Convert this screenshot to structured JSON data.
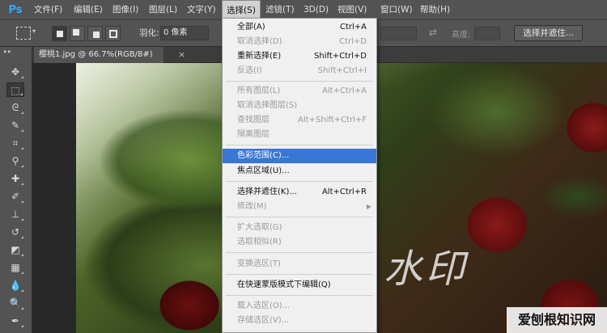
{
  "app": {
    "logo": "Ps"
  },
  "menubar": {
    "items": [
      {
        "label": "文件(F)"
      },
      {
        "label": "编辑(E)"
      },
      {
        "label": "图像(I)"
      },
      {
        "label": "图层(L)"
      },
      {
        "label": "文字(Y)"
      },
      {
        "label": "选择(S)",
        "active": true
      },
      {
        "label": "滤镜(T)"
      },
      {
        "label": "3D(D)"
      },
      {
        "label": "视图(V)"
      },
      {
        "label": "窗口(W)"
      },
      {
        "label": "帮助(H)"
      }
    ]
  },
  "options": {
    "feather_label": "羽化:",
    "feather_value": "0 像素",
    "height_label": "高度:",
    "refine_button": "选择并遮住..."
  },
  "document": {
    "tab_title": "樱桃1.jpg @ 66.7%(RGB/8#)",
    "tab_close": "×",
    "watermark": "水印",
    "site_mark": "爱刨根知识网"
  },
  "select_menu": {
    "items": [
      {
        "label": "全部(A)",
        "shortcut": "Ctrl+A",
        "enabled": true
      },
      {
        "label": "取消选择(D)",
        "shortcut": "Ctrl+D",
        "enabled": false
      },
      {
        "label": "重新选择(E)",
        "shortcut": "Shift+Ctrl+D",
        "enabled": true
      },
      {
        "label": "反选(I)",
        "shortcut": "Shift+Ctrl+I",
        "enabled": false
      },
      {
        "label": "所有图层(L)",
        "shortcut": "Alt+Ctrl+A",
        "enabled": false
      },
      {
        "label": "取消选择图层(S)",
        "shortcut": "",
        "enabled": false
      },
      {
        "label": "查找图层",
        "shortcut": "Alt+Shift+Ctrl+F",
        "enabled": false
      },
      {
        "label": "隔离图层",
        "shortcut": "",
        "enabled": false
      },
      {
        "label": "色彩范围(C)...",
        "shortcut": "",
        "enabled": true,
        "highlighted": true
      },
      {
        "label": "焦点区域(U)...",
        "shortcut": "",
        "enabled": true
      },
      {
        "label": "选择并遮住(K)...",
        "shortcut": "Alt+Ctrl+R",
        "enabled": true
      },
      {
        "label": "修改(M)",
        "shortcut": "",
        "enabled": false,
        "submenu": true
      },
      {
        "label": "扩大选取(G)",
        "shortcut": "",
        "enabled": false
      },
      {
        "label": "选取相似(R)",
        "shortcut": "",
        "enabled": false
      },
      {
        "label": "变换选区(T)",
        "shortcut": "",
        "enabled": false
      },
      {
        "label": "在快速蒙版模式下编辑(Q)",
        "shortcut": "",
        "enabled": true
      },
      {
        "label": "载入选区(O)...",
        "shortcut": "",
        "enabled": false
      },
      {
        "label": "存储选区(V)...",
        "shortcut": "",
        "enabled": false
      }
    ],
    "submenu_arrow": "▶"
  },
  "tools": [
    {
      "name": "move-tool-icon",
      "glyph": "✥"
    },
    {
      "name": "rect-marquee-tool-icon",
      "glyph": "⬚",
      "active": true
    },
    {
      "name": "lasso-tool-icon",
      "glyph": "ᘓ"
    },
    {
      "name": "quick-select-tool-icon",
      "glyph": "✎"
    },
    {
      "name": "crop-tool-icon",
      "glyph": "⌗"
    },
    {
      "name": "eyedropper-tool-icon",
      "glyph": "⚲"
    },
    {
      "name": "healing-brush-tool-icon",
      "glyph": "✚"
    },
    {
      "name": "brush-tool-icon",
      "glyph": "✐"
    },
    {
      "name": "clone-stamp-tool-icon",
      "glyph": "⊥"
    },
    {
      "name": "history-brush-tool-icon",
      "glyph": "↺"
    },
    {
      "name": "eraser-tool-icon",
      "glyph": "◩"
    },
    {
      "name": "gradient-tool-icon",
      "glyph": "▦"
    },
    {
      "name": "blur-tool-icon",
      "glyph": "💧"
    },
    {
      "name": "dodge-tool-icon",
      "glyph": "🔍"
    },
    {
      "name": "pen-tool-icon",
      "glyph": "✒"
    }
  ],
  "colors": {
    "menu_highlight": "#3a77d4",
    "ps_logo": "#31a8ff"
  }
}
